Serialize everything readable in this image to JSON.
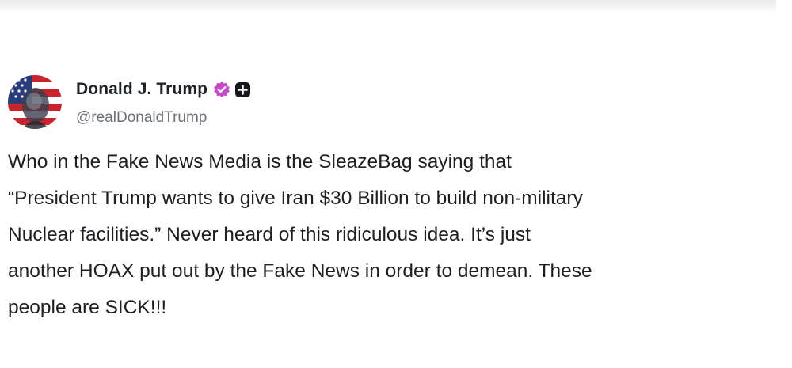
{
  "post": {
    "author": {
      "display_name": "Donald J. Trump",
      "handle": "@realDonaldTrump",
      "verified": true,
      "avatar_icon": "avatar-flag-portrait-icon",
      "verified_icon": "verified-badge-icon",
      "extra_badge_icon": "plus-badge-icon"
    },
    "body_lines": [
      "Who in the Fake News Media is the SleazeBag saying that",
      "“President Trump wants to give Iran $30 Billion to build non-military",
      "Nuclear facilities.” Never heard of this ridiculous idea. It’s just",
      "another HOAX put out by the Fake News in order to demean. These",
      "people are SICK!!!"
    ]
  },
  "colors": {
    "verified_badge": "#c64ac9",
    "text_primary": "#1d1f23",
    "text_secondary": "#6b6f76",
    "badge_dark": "#16181c"
  }
}
